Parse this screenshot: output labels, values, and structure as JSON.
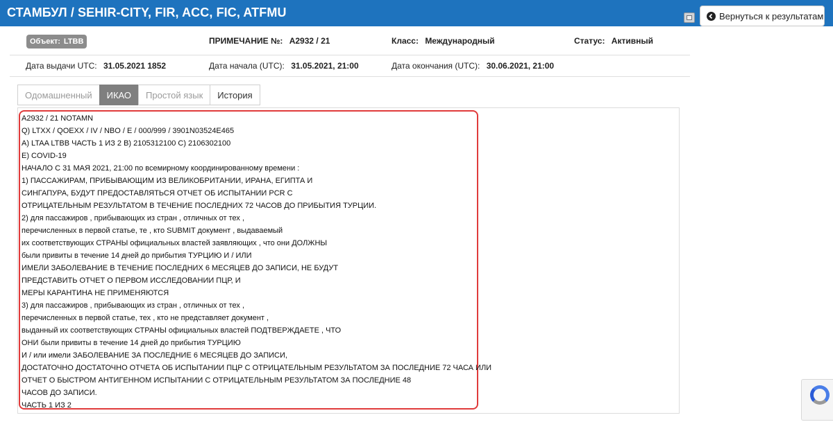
{
  "header": {
    "title": "СТАМБУЛ / SEHIR-CITY, FIR, ACC, FIC, ATFMU",
    "back_label": "Вернуться к результатам"
  },
  "meta": {
    "object_label": "Объект:",
    "object_value": "LTBB",
    "note_label": "ПРИМЕЧАНИЕ №:",
    "note_value": "A2932 / 21",
    "class_label": "Класс:",
    "class_value": "Международный",
    "status_label": "Статус:",
    "status_value": "Активный",
    "issue_label": "Дата выдачи UTC:",
    "issue_value": "31.05.2021 1852",
    "start_label": "Дата начала (UTC):",
    "start_value": "31.05.2021, 21:00",
    "end_label": "Дата окончания (UTC):",
    "end_value": "30.06.2021, 21:00"
  },
  "tabs": [
    {
      "label": "Одомашненный"
    },
    {
      "label": "ИКАО"
    },
    {
      "label": "Простой язык"
    },
    {
      "label": "История"
    }
  ],
  "notam_lines": [
    "A2932 / 21 NOTAMN",
    "Q) LTXX / QOEXX / IV / NBO / E / 000/999 / 3901N03524E465",
    "A) LTAA LTBB ЧАСТЬ 1 ИЗ 2 B) 2105312100 C) 2106302100",
    "E) COVID-19",
    "НАЧАЛО С 31 МАЯ 2021, 21:00 по всемирному координированному времени :",
    "1) ПАССАЖИРАМ, ПРИБЫВАЮЩИМ ИЗ ВЕЛИКОБРИТАНИИ, ИРАНА, ЕГИПТА И",
    "СИНГАПУРА, БУДУТ ПРЕДОСТАВЛЯТЬСЯ ОТЧЕТ ОБ ИСПЫТАНИИ PCR С",
    "ОТРИЦАТЕЛЬНЫМ РЕЗУЛЬТАТОМ В ТЕЧЕНИЕ ПОСЛЕДНИХ 72 ЧАСОВ ДО ПРИБЫТИЯ ТУРЦИИ.",
    "2) для пассажиров , прибывающих из стран , отличных от тех ,",
    "перечисленных в первой статье, те , кто SUBMIT документ , выдаваемый",
    "их соответствующих СТРАНЫ официальных властей заявляющих , что они ДОЛЖНЫ",
    "были привиты в течение 14 дней до прибытия ТУРЦИЮ И / ИЛИ",
    "ИМЕЛИ ЗАБОЛЕВАНИЕ В ТЕЧЕНИЕ ПОСЛЕДНИХ 6 МЕСЯЦЕВ ДО ЗАПИСИ, НЕ БУДУТ",
    "ПРЕДСТАВИТЬ ОТЧЕТ О ПЕРВОМ ИССЛЕДОВАНИИ ПЦР, И",
    "МЕРЫ КАРАНТИНА НЕ ПРИМЕНЯЮТСЯ",
    "3) для пассажиров , прибывающих из стран , отличных от тех ,",
    "перечисленных в первой статье, тех , кто не представляет документ ,",
    "выданный их соответствующих СТРАНЫ официальных властей ПОДТВЕРЖДАЕТЕ , ЧТО",
    "ОНИ были привиты в течение 14 дней до прибытия ТУРЦИЮ",
    "И / или имели ЗАБОЛЕВАНИЕ ЗА ПОСЛЕДНИЕ 6 МЕСЯЦЕВ ДО ЗАПИСИ,",
    "ДОСТАТОЧНО ДОСТАТОЧНО ОТЧЕТА ОБ ИСПЫТАНИИ ПЦР С ОТРИЦАТЕЛЬНЫМ РЕЗУЛЬТАТОМ ЗА ПОСЛЕДНИЕ 72 ЧАСА ИЛИ",
    "ОТЧЕТ О БЫСТРОМ АНТИГЕННОМ ИСПЫТАНИИ С ОТРИЦАТЕЛЬНЫМ РЕЗУЛЬТАТОМ ЗА ПОСЛЕДНИЕ 48",
    "ЧАСОВ ДО ЗАПИСИ.",
    "ЧАСТЬ 1 ИЗ 2"
  ],
  "colors": {
    "header_bg": "#1e73be",
    "active_tab": "#7f7f7f",
    "highlight": "#e03a3a"
  },
  "icons": {
    "back": "arrow-circle-left-icon",
    "pdf": "document-icon",
    "recaptcha": "recaptcha-logo-icon"
  }
}
